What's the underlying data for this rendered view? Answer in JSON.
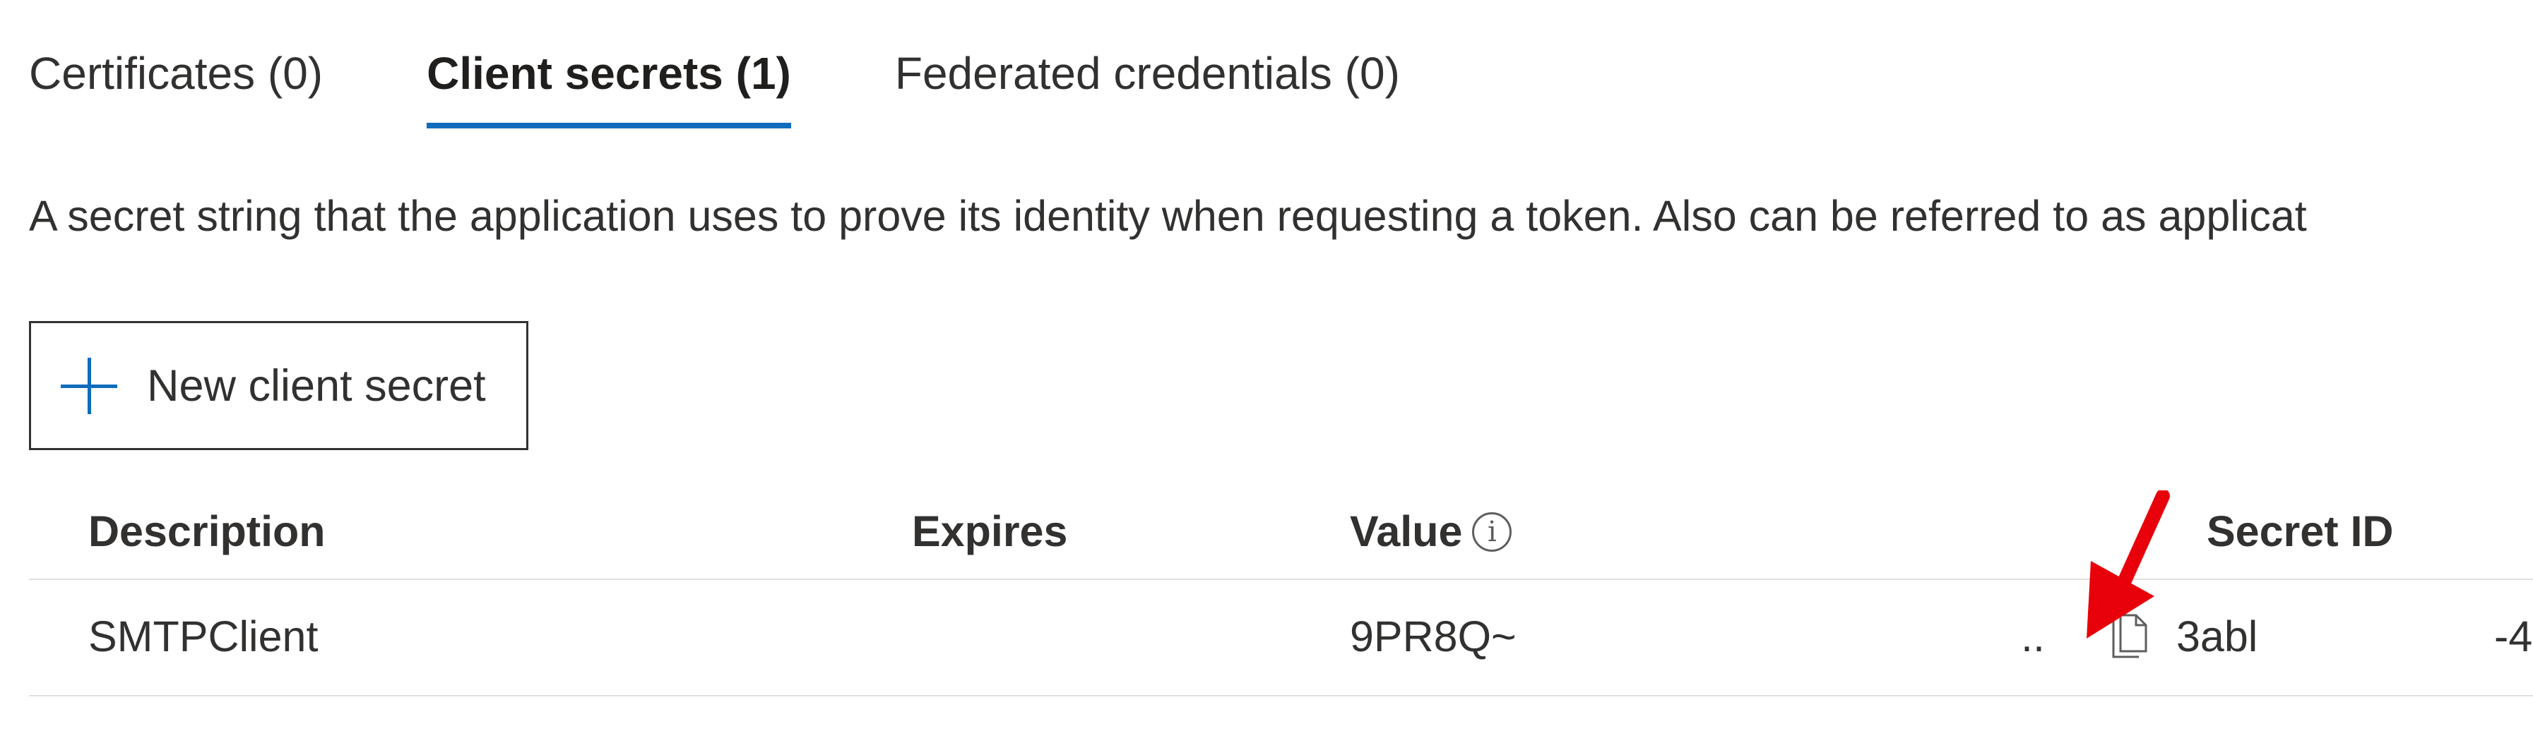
{
  "tabs": [
    {
      "label": "Certificates (0)",
      "active": false
    },
    {
      "label": "Client secrets (1)",
      "active": true
    },
    {
      "label": "Federated credentials (0)",
      "active": false
    }
  ],
  "description": "A secret string that the application uses to prove its identity when requesting a token. Also can be referred to as applicat",
  "new_button": {
    "label": "New client secret",
    "icon": "plus-icon"
  },
  "table": {
    "columns": [
      "Description",
      "Expires",
      "Value",
      "Secret ID"
    ],
    "value_info_icon": "info-icon",
    "rows": [
      {
        "description": "SMTPClient",
        "expires": "",
        "value": "9PR8Q~",
        "value_ellipsis": "..",
        "secret_id": "3abl",
        "secret_id_tail": "-4"
      }
    ]
  },
  "colors": {
    "accent": "#0f6cbd",
    "annotation_arrow": "#e8000b"
  }
}
